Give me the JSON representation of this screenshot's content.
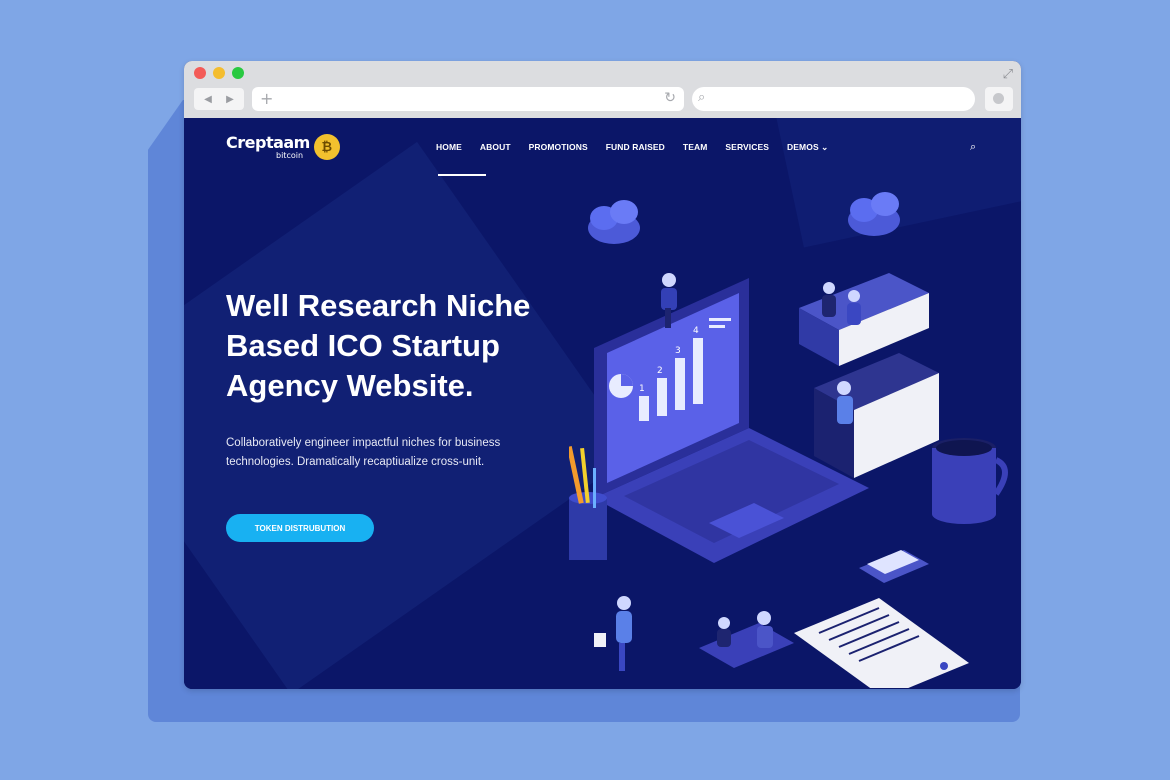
{
  "browser": {
    "url": "",
    "search_placeholder": ""
  },
  "site": {
    "logo": {
      "name": "Creptaam",
      "tagline": "bitcoin"
    },
    "menu": [
      {
        "label": "HOME"
      },
      {
        "label": "ABOUT"
      },
      {
        "label": "PROMOTIONS"
      },
      {
        "label": "FUND RAISED"
      },
      {
        "label": "TEAM"
      },
      {
        "label": "SERVICES"
      },
      {
        "label": "DEMOS ⌄"
      }
    ],
    "active_menu": "HOME",
    "hero": {
      "title_line1": "Well Research Niche",
      "title_line2": "Based ICO Startup",
      "title_line3": "Agency Website.",
      "subtitle_line1": "Collaboratively engineer impactful niches for business",
      "subtitle_line2": "technologies. Dramatically recaptiualize cross-unit.",
      "cta_label": "TOKEN DISTRUBUTION"
    },
    "chart_labels": [
      "1",
      "2",
      "3",
      "4"
    ],
    "colors": {
      "page_bg": "#7fa6e6",
      "hero_bg": "#0b1668",
      "cta": "#18b1f2",
      "coin": "#f2c12e"
    },
    "icons": [
      "search-icon",
      "bitcoin-coin-icon",
      "cloud-icon",
      "chevron-down-icon"
    ]
  }
}
